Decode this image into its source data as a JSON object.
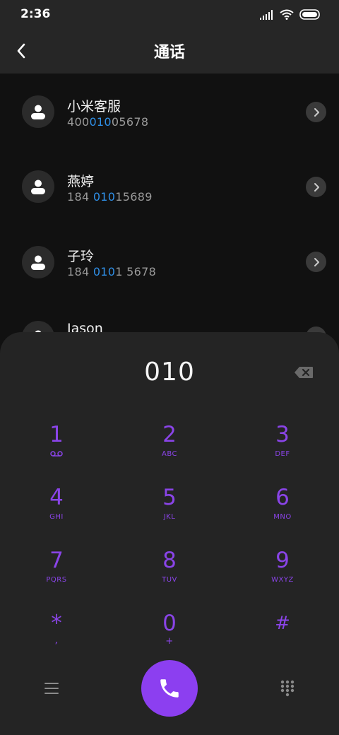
{
  "status_bar": {
    "time": "2:36",
    "icons": [
      "signal-icon",
      "wifi-icon",
      "battery-icon"
    ]
  },
  "app_bar": {
    "title": "通话",
    "back_icon": "back-arrow-icon"
  },
  "contacts": [
    {
      "name": "小米客服",
      "number_pre": "400",
      "number_match": "010",
      "number_post": "05678"
    },
    {
      "name": "燕婷",
      "number_pre": "184 ",
      "number_match": "010",
      "number_post": "15689"
    },
    {
      "name": "子玲",
      "number_pre": "184 ",
      "number_match": "010",
      "number_post": "1 5678"
    },
    {
      "name": "Jason",
      "number_pre": "",
      "number_match": "",
      "number_post": ""
    }
  ],
  "dialer": {
    "input_value": "010",
    "keys": [
      {
        "digit": "1",
        "letters": ""
      },
      {
        "digit": "2",
        "letters": "ABC"
      },
      {
        "digit": "3",
        "letters": "DEF"
      },
      {
        "digit": "4",
        "letters": "GHI"
      },
      {
        "digit": "5",
        "letters": "JKL"
      },
      {
        "digit": "6",
        "letters": "MNO"
      },
      {
        "digit": "7",
        "letters": "PQRS"
      },
      {
        "digit": "8",
        "letters": "TUV"
      },
      {
        "digit": "9",
        "letters": "WXYZ"
      },
      {
        "digit": "*",
        "letters": ","
      },
      {
        "digit": "0",
        "letters": "+"
      },
      {
        "digit": "#",
        "letters": ""
      }
    ]
  },
  "colors": {
    "accent": "#8c3ff0",
    "match_highlight": "#2f8fe6",
    "background": "#121212",
    "panel": "#242424"
  }
}
